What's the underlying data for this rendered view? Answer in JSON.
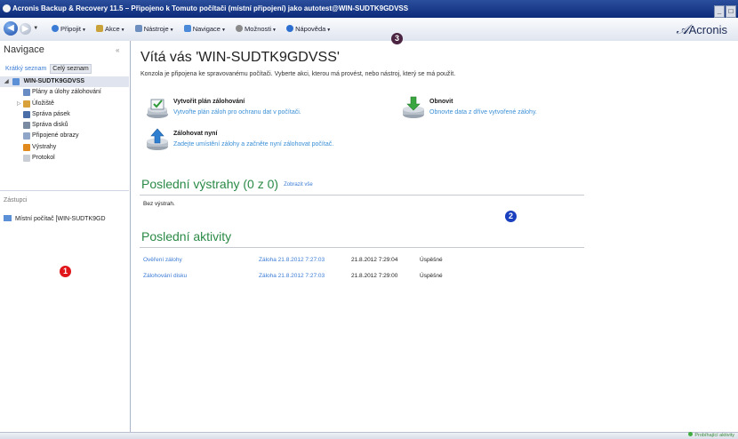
{
  "window": {
    "title": "Acronis Backup & Recovery 11.5 – Připojeno k Tomuto počítači (místní připojení) jako autotest@WIN-SUDTK9GDVSS",
    "minimize": "_",
    "restore": "□"
  },
  "toolbar": {
    "items": [
      {
        "label": "Připojit",
        "icon": "connect-icon",
        "color": "#3a7bd5"
      },
      {
        "label": "Akce",
        "icon": "actions-icon",
        "color": "#c9a23a"
      },
      {
        "label": "Nástroje",
        "icon": "tools-icon",
        "color": "#6c8fbf"
      },
      {
        "label": "Navigace",
        "icon": "navigation-icon",
        "color": "#4a8ad8"
      },
      {
        "label": "Možnosti",
        "icon": "options-icon",
        "color": "#8a8a8a"
      },
      {
        "label": "Nápověda",
        "icon": "help-icon",
        "color": "#2d6fd0"
      }
    ],
    "brand": "Acronis"
  },
  "navigation": {
    "title": "Navigace",
    "collapse": "«",
    "tabs": [
      "Krátký seznam",
      "Celý seznam"
    ],
    "root": "WIN-SUDTK9GDVSS",
    "items": [
      {
        "label": "Plány a úlohy zálohování",
        "icon": "plans-icon"
      },
      {
        "label": "Úložiště",
        "icon": "vault-icon"
      },
      {
        "label": "Správa pásek",
        "icon": "tape-icon"
      },
      {
        "label": "Správa disků",
        "icon": "disk-icon"
      },
      {
        "label": "Připojené obrazy",
        "icon": "mounted-image-icon"
      },
      {
        "label": "Výstrahy",
        "icon": "alert-icon"
      },
      {
        "label": "Protokol",
        "icon": "log-icon"
      }
    ]
  },
  "agents": {
    "title": "Zástupci",
    "item": "Místní počítač [WIN-SUDTK9GD"
  },
  "main": {
    "welcome": "Vítá vás 'WIN-SUDTK9GDVSS'",
    "subtitle": "Konzola je připojena ke spravovanému počítači. Vyberte akci, kterou má provést, nebo nástroj, který se má použít.",
    "actions": [
      {
        "title": "Vytvořit plán zálohování",
        "desc": "Vytvořte plán záloh pro ochranu dat v počítači."
      },
      {
        "title": "Obnovit",
        "desc": "Obnovte data z dříve vytvořené zálohy."
      },
      {
        "title": "Zálohovat nyní",
        "desc": "Zadejte umístění zálohy a začněte nyní zálohovat počítač."
      }
    ],
    "alerts_title": "Poslední výstrahy (0 z 0)",
    "alerts_link": "Zobrazit vše",
    "no_alerts": "Bez výstrah.",
    "activities_title": "Poslední aktivity",
    "activities": [
      {
        "name": "Ověření zálohy",
        "backup": "Záloha 21.8.2012 7:27:03",
        "time": "21.8.2012 7:29:04",
        "result": "Úspěšné"
      },
      {
        "name": "Zálohování disku",
        "backup": "Záloha 21.8.2012 7:27:03",
        "time": "21.8.2012 7:29:00",
        "result": "Úspěšné"
      }
    ]
  },
  "callouts": [
    "1",
    "2",
    "3"
  ],
  "statusbar": {
    "text": "Probíhající aktivity"
  }
}
